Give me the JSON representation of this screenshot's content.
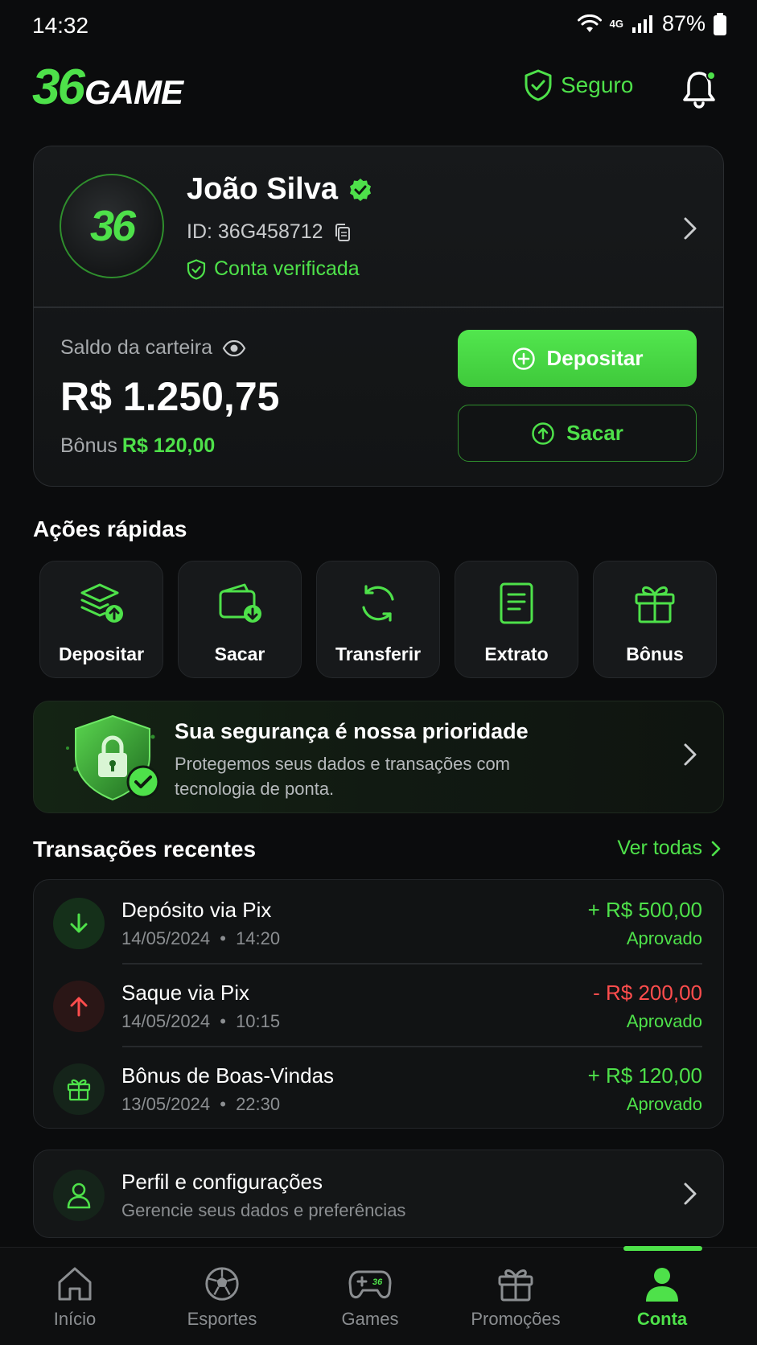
{
  "status_bar": {
    "time": "14:32",
    "network": "4G",
    "battery": "87%"
  },
  "header": {
    "logo_number": "36",
    "logo_text": "GAME",
    "secure_label": "Seguro"
  },
  "account": {
    "avatar_text": "36",
    "name": "João Silva",
    "id_label": "ID: 36G458712",
    "verified_label": "Conta verificada",
    "balance_label": "Saldo da carteira",
    "balance_value": "R$ 1.250,75",
    "bonus_label": "Bônus",
    "bonus_value": "R$ 120,00",
    "deposit_button": "Depositar",
    "withdraw_button": "Sacar"
  },
  "quick_actions": {
    "title": "Ações rápidas",
    "items": [
      {
        "label": "Depositar",
        "icon": "deposit-stack-icon"
      },
      {
        "label": "Sacar",
        "icon": "wallet-withdraw-icon"
      },
      {
        "label": "Transferir",
        "icon": "transfer-refresh-icon"
      },
      {
        "label": "Extrato",
        "icon": "statement-document-icon"
      },
      {
        "label": "Bônus",
        "icon": "gift-icon"
      }
    ]
  },
  "security_banner": {
    "title": "Sua segurança é nossa prioridade",
    "description": "Protegemos seus dados e transações com tecnologia de ponta."
  },
  "transactions": {
    "title": "Transações recentes",
    "see_all": "Ver todas",
    "items": [
      {
        "title": "Depósito via Pix",
        "date": "14/05/2024",
        "time": "14:20",
        "amount": "+ R$ 500,00",
        "status": "Aprovado",
        "type": "deposit"
      },
      {
        "title": "Saque via Pix",
        "date": "14/05/2024",
        "time": "10:15",
        "amount": "- R$ 200,00",
        "status": "Aprovado",
        "type": "withdraw"
      },
      {
        "title": "Bônus de Boas-Vindas",
        "date": "13/05/2024",
        "time": "22:30",
        "amount": "+ R$ 120,00",
        "status": "Aprovado",
        "type": "bonus"
      }
    ]
  },
  "profile": {
    "title": "Perfil e configurações",
    "subtitle": "Gerencie seus dados e preferências"
  },
  "bottom_nav": {
    "items": [
      {
        "label": "Início",
        "icon": "home-icon"
      },
      {
        "label": "Esportes",
        "icon": "soccer-ball-icon"
      },
      {
        "label": "Games",
        "icon": "gamepad-icon",
        "badge": "36"
      },
      {
        "label": "Promoções",
        "icon": "gift-icon"
      },
      {
        "label": "Conta",
        "icon": "user-icon",
        "active": true
      }
    ]
  },
  "colors": {
    "accent": "#4ee14a",
    "negative": "#ff4d4d",
    "background": "#0b0c0d"
  }
}
